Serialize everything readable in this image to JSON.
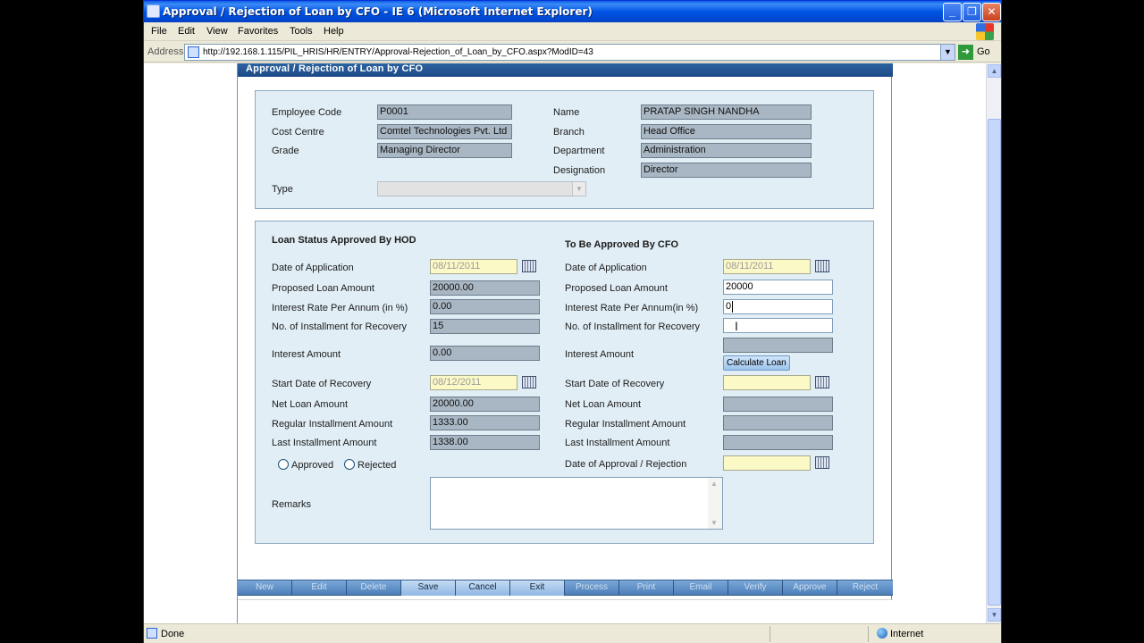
{
  "window": {
    "title": "Approval / Rejection of Loan by CFO - IE 6 (Microsoft Internet Explorer)",
    "min_icon": "minimize-icon",
    "max_icon": "restore-icon",
    "close_icon": "close-icon"
  },
  "menu": [
    "File",
    "Edit",
    "View",
    "Favorites",
    "Tools",
    "Help"
  ],
  "address": {
    "label": "Address",
    "url": "http://192.168.1.115/PIL_HRIS/HR/ENTRY/Approval-Rejection_of_Loan_by_CFO.aspx?ModID=43",
    "go_label": "Go"
  },
  "status": {
    "text": "Done",
    "zone": "Internet"
  },
  "page": {
    "header": "Approval / Rejection of Loan by CFO",
    "employee": {
      "code_label": "Employee Code",
      "code": "P0001",
      "name_label": "Name",
      "name": "PRATAP SINGH NANDHA",
      "cost_centre_label": "Cost Centre",
      "cost_centre": "Comtel Technologies Pvt. Ltd",
      "branch_label": "Branch",
      "branch": "Head Office",
      "grade_label": "Grade",
      "grade": "Managing Director",
      "department_label": "Department",
      "department": "Administration",
      "designation_label": "Designation",
      "designation": "Director",
      "type_label": "Type",
      "type_value": ""
    },
    "hod": {
      "heading": "Loan Status Approved By HOD",
      "date_label": "Date of Application",
      "date": "08/11/2011",
      "amount_label": "Proposed Loan Amount",
      "amount": "20000.00",
      "rate_label": "Interest Rate Per Annum (in %)",
      "rate": "0.00",
      "inst_label": "No. of Installment for Recovery",
      "inst": "15",
      "interest_label": "Interest Amount",
      "interest": "0.00",
      "start_label": "Start Date of Recovery",
      "start": "08/12/2011",
      "net_label": "Net Loan Amount",
      "net": "20000.00",
      "regular_label": "Regular Installment Amount",
      "regular": "1333.00",
      "last_label": "Last Installment Amount",
      "last": "1338.00",
      "approved_label": "Approved",
      "rejected_label": "Rejected",
      "remarks_label": "Remarks"
    },
    "cfo": {
      "heading": "To Be Approved By CFO",
      "date_label": "Date of Application",
      "date": "08/11/2011",
      "amount_label": "Proposed Loan Amount",
      "amount": "20000",
      "rate_label": "Interest Rate Per Annum(in %)",
      "rate": "0",
      "inst_label": "No. of Installment for Recovery",
      "inst": "",
      "interest_label": "Interest Amount",
      "interest": "",
      "calc_label": "Calculate Loan",
      "start_label": "Start Date of Recovery",
      "start": "",
      "net_label": "Net Loan Amount",
      "regular_label": "Regular Installment Amount",
      "last_label": "Last Installment Amount",
      "approval_date_label": "Date of Approval / Rejection",
      "approval_date": ""
    },
    "toolbar": [
      "New",
      "Edit",
      "Delete",
      "Save",
      "Cancel",
      "Exit",
      "Process",
      "Print",
      "Email",
      "Verify",
      "Approve",
      "Reject"
    ]
  }
}
